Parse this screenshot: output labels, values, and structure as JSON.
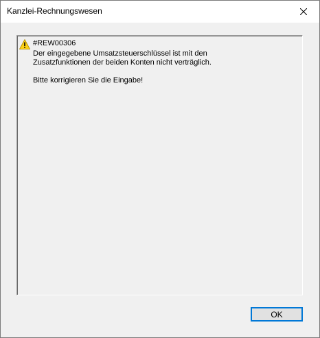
{
  "window": {
    "title": "Kanzlei-Rechnungswesen",
    "close_icon": "close-icon"
  },
  "message": {
    "icon": "warning-icon",
    "code": "#REW00306",
    "line1": "Der eingegebene Umsatzsteuerschlüssel ist mit den",
    "line2": "Zusatzfunktionen der beiden Konten nicht verträglich.",
    "hint": "Bitte korrigieren Sie die Eingabe!"
  },
  "buttons": {
    "ok_label": "OK"
  },
  "colors": {
    "accent": "#0078d7",
    "warning": "#fcd116"
  }
}
